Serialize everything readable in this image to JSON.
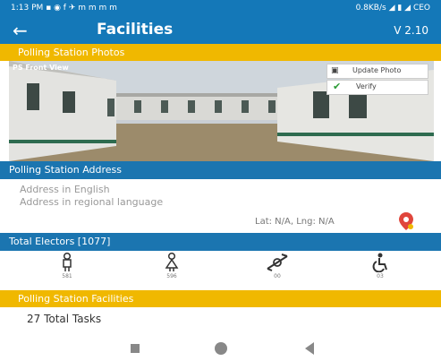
{
  "status_bar": {
    "left": "1:13 PM ▪ ◉ f ✈ m m m m",
    "right": "0.8KB/s ◢ ▮ ◢ CEO"
  },
  "app_bar": {
    "back_icon": "arrow-left-icon",
    "title": "Facilities",
    "version": "V 2.10"
  },
  "photos_section": {
    "title": "Polling Station Photos",
    "caption": "PS Front View",
    "update_label": "Update Photo",
    "verify_label": "Verify",
    "carousel_pages": 2
  },
  "address_section": {
    "title": "Polling Station Address",
    "address_english": "Address in English",
    "address_regional": "Address in regional language",
    "lat_lng": "Lat: N/A, Lng: N/A",
    "pin_icon": "map-pin-icon"
  },
  "electors_section": {
    "title": "Total Electors [1077]",
    "icons": [
      {
        "icon": "male-icon",
        "value": "581"
      },
      {
        "icon": "female-icon",
        "value": "596"
      },
      {
        "icon": "third-gender-icon",
        "value": "00"
      },
      {
        "icon": "wheelchair-icon",
        "value": "03"
      }
    ]
  },
  "facilities_section": {
    "title": "Polling Station Facilities",
    "tasks_label": "27 Total Tasks"
  },
  "colors": {
    "primary_blue": "#1478b8",
    "section_blue": "#1b75b0",
    "accent_yellow": "#f0b800"
  }
}
